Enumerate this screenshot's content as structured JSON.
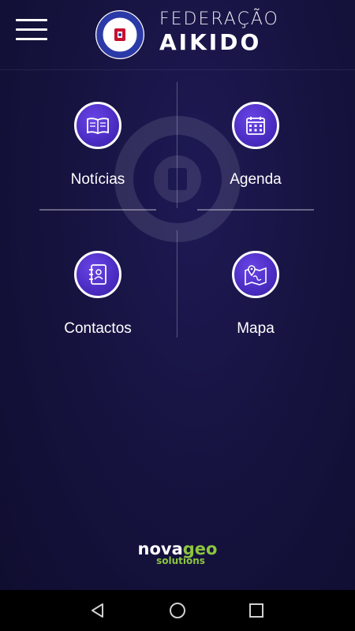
{
  "header": {
    "menu_icon": "hamburger-menu-icon",
    "logo_icon": "fpa-federation-seal-icon",
    "title_line1": "FEDERAÇÃO",
    "title_line2": "AIKIDO"
  },
  "grid": {
    "items": [
      {
        "label": "Notícias",
        "icon": "newspaper-icon"
      },
      {
        "label": "Agenda",
        "icon": "calendar-icon"
      },
      {
        "label": "Contactos",
        "icon": "contact-book-icon"
      },
      {
        "label": "Mapa",
        "icon": "map-pin-icon"
      }
    ]
  },
  "footer": {
    "brand_part1": "nova",
    "brand_part2": "geo",
    "brand_sub": "solutions"
  },
  "navbar": {
    "back_icon": "back-triangle-icon",
    "home_icon": "home-circle-icon",
    "recents_icon": "recents-square-icon"
  },
  "colors": {
    "background": "#161340",
    "icon_circle": "#4a2cc2",
    "brand_green": "#8dc63f",
    "navbar": "#000000"
  }
}
